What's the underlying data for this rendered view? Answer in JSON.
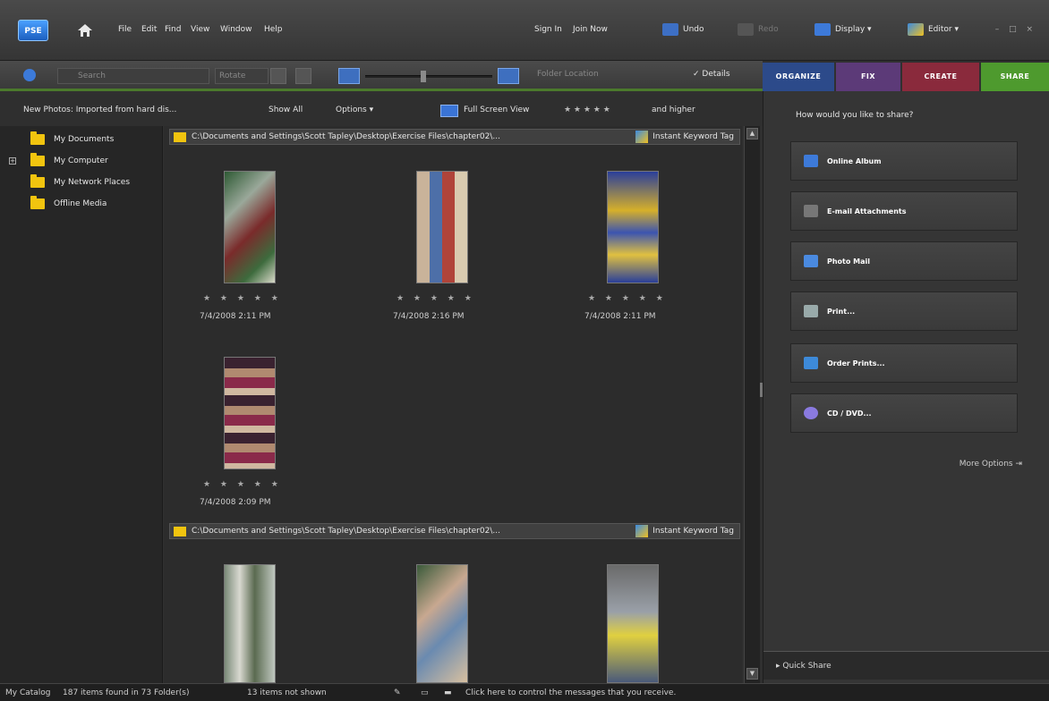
{
  "app": {
    "logo_text": "PSE"
  },
  "menu": {
    "items": [
      "File",
      "Edit",
      "Find",
      "View",
      "Window",
      "Help"
    ],
    "sign_in": "Sign In",
    "join_now": "Join Now"
  },
  "actions": {
    "undo": "Undo",
    "redo": "Redo",
    "display": "Display ▾",
    "editor": "Editor ▾",
    "window_controls": "– □ ×"
  },
  "toolbar": {
    "search_placeholder": "Search",
    "rotate": "Rotate",
    "folder_location": "Folder Location",
    "details": "✓ Details"
  },
  "tabs": [
    {
      "label": "ORGANIZE",
      "color": "#2c4a8a"
    },
    {
      "label": "FIX",
      "color": "#5c3a78"
    },
    {
      "label": "CREATE",
      "color": "#8a2a3c"
    },
    {
      "label": "SHARE",
      "color": "#4e9a2e"
    }
  ],
  "options_bar": {
    "new_photos": "New Photos: Imported from hard dis...",
    "show_all": "Show All",
    "options": "Options ▾",
    "full_screen": "Full Screen View",
    "rating_stars": "★ ★ ★ ★ ★",
    "and_higher": "and higher"
  },
  "tree": {
    "items": [
      "My Documents",
      "My Computer",
      "My Network Places",
      "Offline Media"
    ],
    "expand": "+"
  },
  "groups": [
    {
      "path": "C:\\Documents and Settings\\Scott Tapley\\Desktop\\Exercise Files\\chapter02\\...",
      "instant_tag": "Instant Keyword Tag",
      "photos": [
        {
          "date": "7/4/2008 2:11 PM",
          "stars": "★ ★ ★ ★ ★"
        },
        {
          "date": "7/4/2008 2:16 PM",
          "stars": "★ ★ ★ ★ ★"
        },
        {
          "date": "7/4/2008 2:11 PM",
          "stars": "★ ★ ★ ★ ★"
        },
        {
          "date": "7/4/2008 2:09 PM",
          "stars": "★ ★ ★ ★ ★"
        }
      ]
    },
    {
      "path": "C:\\Documents and Settings\\Scott Tapley\\Desktop\\Exercise Files\\chapter02\\...",
      "instant_tag": "Instant Keyword Tag"
    }
  ],
  "share_panel": {
    "question": "How would you like to share?",
    "buttons": [
      {
        "label": "Online Album",
        "icon": "online-album-icon"
      },
      {
        "label": "E-mail Attachments",
        "icon": "email-icon"
      },
      {
        "label": "Photo Mail",
        "icon": "photo-mail-icon"
      },
      {
        "label": "Print...",
        "icon": "printer-icon"
      },
      {
        "label": "Order Prints...",
        "icon": "order-prints-icon"
      },
      {
        "label": "CD / DVD...",
        "icon": "disc-icon"
      }
    ],
    "more_options": "More Options ⇥",
    "quick_share": "▸ Quick Share"
  },
  "status": {
    "catalog": "My Catalog",
    "count": "187 items found in 73 Folder(s)",
    "not_shown": "13 items not shown",
    "message": "Click here to control the messages that you receive."
  }
}
